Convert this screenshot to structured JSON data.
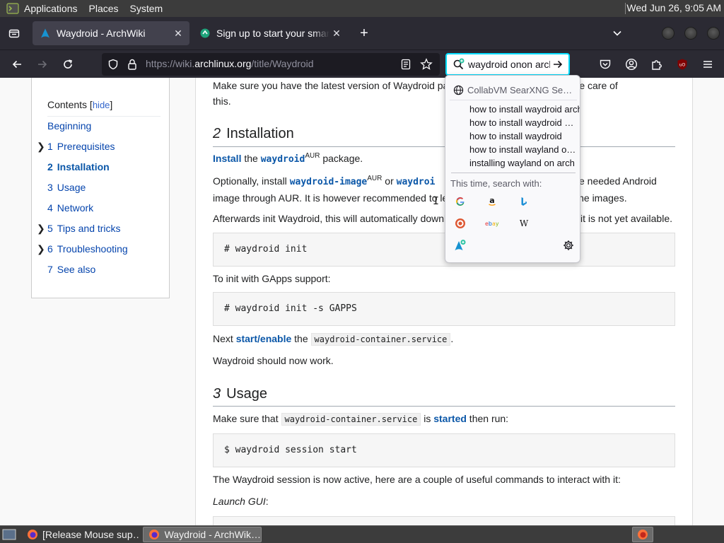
{
  "top_panel": {
    "menus": [
      "Applications",
      "Places",
      "System"
    ],
    "clock": "Wed Jun 26,  9:05 AM"
  },
  "browser": {
    "tabs": [
      {
        "title": "Waydroid - ArchWiki",
        "active": true
      },
      {
        "title": "Sign up to start your smart",
        "active": false
      }
    ],
    "url_prefix": "https://wiki.",
    "url_host": "archlinux.org",
    "url_path": "/title/Waydroid",
    "search_query": "waydroid onon arch",
    "dropdown": {
      "engine_label": "CollabVM SearXNG Se…",
      "suggestions": [
        "how to install waydroid arch",
        "how to install waydroid …",
        "how to install waydroid",
        "how to install wayland o…",
        "installing wayland on arch"
      ],
      "this_time_label": "This time, search with:",
      "engines": [
        "G",
        "a",
        "b",
        "ddg",
        "ebay",
        "W",
        "archwiki"
      ]
    }
  },
  "toc": {
    "title": "Contents",
    "hide_label": "hide",
    "items": [
      {
        "num": "",
        "label": "Beginning",
        "expandable": false,
        "current": false
      },
      {
        "num": "1",
        "label": "Prerequisites",
        "expandable": true,
        "current": false
      },
      {
        "num": "2",
        "label": "Installation",
        "expandable": false,
        "current": true
      },
      {
        "num": "3",
        "label": "Usage",
        "expandable": false,
        "current": false
      },
      {
        "num": "4",
        "label": "Network",
        "expandable": false,
        "current": false
      },
      {
        "num": "5",
        "label": "Tips and tricks",
        "expandable": true,
        "current": false
      },
      {
        "num": "6",
        "label": "Troubleshooting",
        "expandable": true,
        "current": false
      },
      {
        "num": "7",
        "label": "See also",
        "expandable": false,
        "current": false
      }
    ]
  },
  "article": {
    "intro_line1": "Make sure you have the latest version of Waydroid pa",
    "intro_line1_tail": "matically take care of",
    "intro_line2": "this.",
    "section2": {
      "num": "2",
      "title": "Installation"
    },
    "install_link": "Install",
    "install_the": " the ",
    "install_pkg": "waydroid",
    "aur": "AUR",
    "install_tail": " package.",
    "optional_1": "Optionally, install ",
    "optional_pkg1": "waydroid-image",
    "optional_or": " or ",
    "optional_pkg2": "waydroi",
    "optional_tail1": " the needed Android",
    "optional_2a": "image through AUR. It is however recommended to le",
    "optional_2b": "oading the images.",
    "afterwards_a": "Afterwards init Waydroid, this will automatically downl",
    "afterwards_b": " it is not yet available.",
    "cmd_init": "# waydroid init",
    "gapps_text": "To init with GApps support:",
    "cmd_gapps": "# waydroid init -s GAPPS",
    "next_a": "Next ",
    "next_link": "start/enable",
    "next_b": " the ",
    "next_code": "waydroid-container.service",
    "next_c": ".",
    "should_work": "Waydroid should now work.",
    "section3": {
      "num": "3",
      "title": "Usage"
    },
    "usage_a": "Make sure that ",
    "usage_code": "waydroid-container.service",
    "usage_b": " is ",
    "usage_link": "started",
    "usage_c": " then run:",
    "cmd_session": "$ waydroid session start",
    "session_text": "The Waydroid session is now active, here are a couple of useful commands to interact with it:",
    "launch_gui": "Launch GUI",
    "launch_colon": ":"
  },
  "taskbar": {
    "items": [
      {
        "label": "[Release Mouse sup…",
        "active": false
      },
      {
        "label": "Waydroid - ArchWik…",
        "active": true
      }
    ]
  },
  "colors": {
    "link": "#0b57a8",
    "toolbar": "#2b2a33",
    "urlbar": "#1c1b22",
    "focus_ring": "#00ddff"
  }
}
